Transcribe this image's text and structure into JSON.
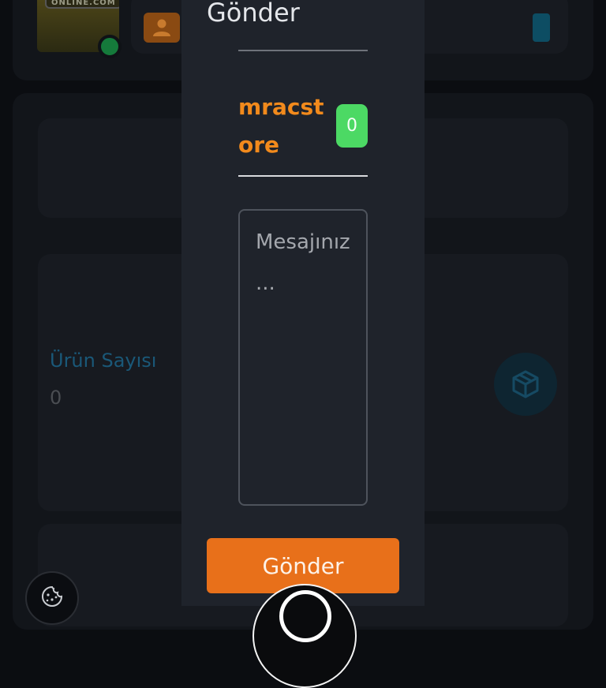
{
  "background": {
    "thumbnail_label": "ONLINE.COM",
    "stat": {
      "title": "Ürün Sayısı",
      "value": "0"
    }
  },
  "modal": {
    "title": "Gönder",
    "store_name": "mracstore",
    "message_count": "0",
    "message_placeholder": "Mesajınız...",
    "send_label": "Gönder"
  },
  "colors": {
    "accent": "#e8701a",
    "store_name": "#f28a1c",
    "badge": "#4cd964",
    "modal_bg": "#1f232b"
  },
  "icons": [
    "user-icon",
    "phone-icon",
    "cube-icon",
    "cookie-icon",
    "support-icon"
  ]
}
